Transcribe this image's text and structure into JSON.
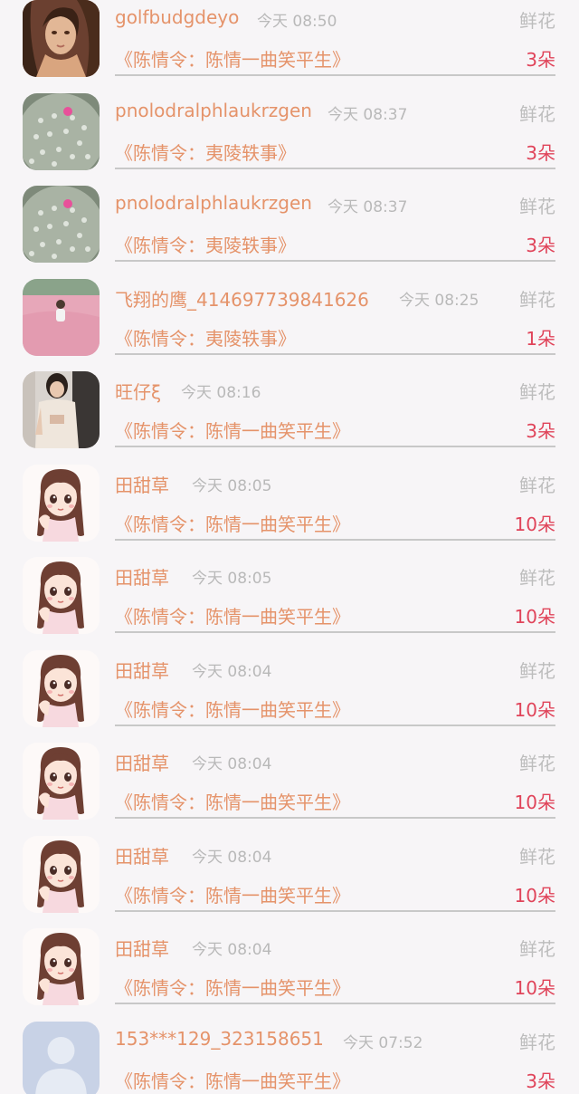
{
  "colors": {
    "name": "#e5936a",
    "title": "#e5936a",
    "time": "#b9b9b9",
    "gift": "#bdbdbd",
    "count": "#e0445a",
    "divider": "#c8c8c8",
    "background": "#f7f5f7"
  },
  "records": [
    {
      "avatar": "woman-photo-avatar",
      "name": "golfbudgdeyo",
      "time": "今天 08:50",
      "gift": "鲜花",
      "title": "《陈情令：陈情一曲笑平生》",
      "count": "3朵"
    },
    {
      "avatar": "cactus-avatar",
      "name": "pnolodralphlaukrzgen",
      "time": "今天 08:37",
      "gift": "鲜花",
      "title": "《陈情令：夷陵轶事》",
      "count": "3朵"
    },
    {
      "avatar": "cactus-avatar",
      "name": "pnolodralphlaukrzgen",
      "time": "今天 08:37",
      "gift": "鲜花",
      "title": "《陈情令：夷陵轶事》",
      "count": "3朵"
    },
    {
      "avatar": "pink-field-avatar",
      "name": "飞翔的鹰_414697739841626",
      "time": "今天 08:25",
      "gift": "鲜花",
      "title": "《陈情令：夷陵轶事》",
      "count": "1朵"
    },
    {
      "avatar": "girl-photo-avatar",
      "name": "旺仔ξ",
      "time": "今天 08:16",
      "gift": "鲜花",
      "title": "《陈情令：陈情一曲笑平生》",
      "count": "3朵"
    },
    {
      "avatar": "anime-girl-avatar",
      "name": "田甜草",
      "time": "今天 08:05",
      "gift": "鲜花",
      "title": "《陈情令：陈情一曲笑平生》",
      "count": "10朵"
    },
    {
      "avatar": "anime-girl-avatar",
      "name": "田甜草",
      "time": "今天 08:05",
      "gift": "鲜花",
      "title": "《陈情令：陈情一曲笑平生》",
      "count": "10朵"
    },
    {
      "avatar": "anime-girl-avatar",
      "name": "田甜草",
      "time": "今天 08:04",
      "gift": "鲜花",
      "title": "《陈情令：陈情一曲笑平生》",
      "count": "10朵"
    },
    {
      "avatar": "anime-girl-avatar",
      "name": "田甜草",
      "time": "今天 08:04",
      "gift": "鲜花",
      "title": "《陈情令：陈情一曲笑平生》",
      "count": "10朵"
    },
    {
      "avatar": "anime-girl-avatar",
      "name": "田甜草",
      "time": "今天 08:04",
      "gift": "鲜花",
      "title": "《陈情令：陈情一曲笑平生》",
      "count": "10朵"
    },
    {
      "avatar": "anime-girl-avatar",
      "name": "田甜草",
      "time": "今天 08:04",
      "gift": "鲜花",
      "title": "《陈情令：陈情一曲笑平生》",
      "count": "10朵"
    },
    {
      "avatar": "default-user-avatar",
      "name": "153***129_323158651",
      "time": "今天 07:52",
      "gift": "鲜花",
      "title": "《陈情令：陈情一曲笑平生》",
      "count": "3朵"
    }
  ]
}
